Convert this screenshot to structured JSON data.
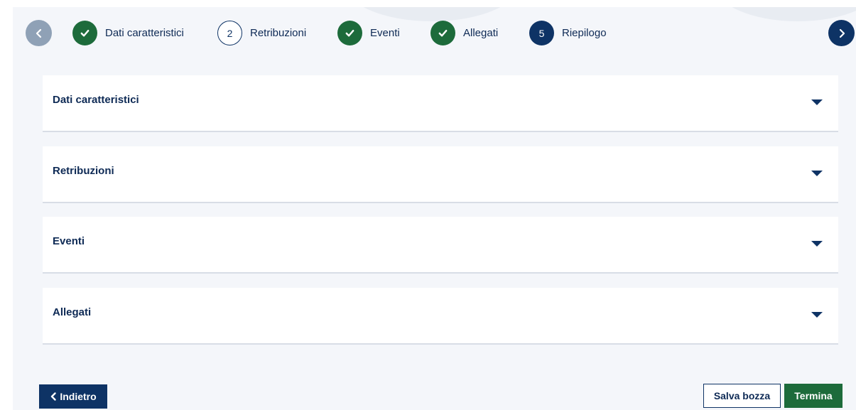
{
  "stepper": {
    "prev_icon": "chevron-left-icon",
    "next_icon": "chevron-right-icon",
    "steps": [
      {
        "number": "",
        "label": "Dati caratteristici",
        "state": "completed"
      },
      {
        "number": "2",
        "label": "Retribuzioni",
        "state": "todo"
      },
      {
        "number": "",
        "label": "Eventi",
        "state": "completed"
      },
      {
        "number": "",
        "label": "Allegati",
        "state": "completed"
      },
      {
        "number": "5",
        "label": "Riepilogo",
        "state": "current"
      }
    ]
  },
  "sections": [
    {
      "title": "Dati caratteristici",
      "expanded": false
    },
    {
      "title": "Retribuzioni",
      "expanded": false
    },
    {
      "title": "Eventi",
      "expanded": false
    },
    {
      "title": "Allegati",
      "expanded": false
    }
  ],
  "footer": {
    "back_label": "Indietro",
    "save_draft_label": "Salva bozza",
    "finish_label": "Termina"
  },
  "colors": {
    "primary": "#0e3365",
    "success": "#1d6b3b",
    "background": "#f4f6fa",
    "inactive_nav": "#8fa1b6"
  }
}
